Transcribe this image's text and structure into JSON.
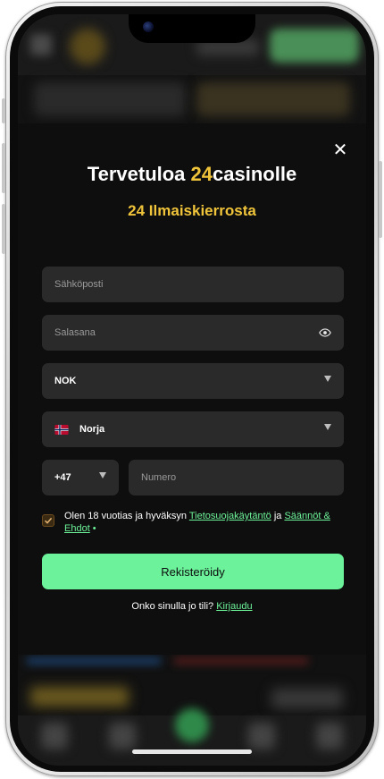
{
  "modal": {
    "close_glyph": "✕",
    "title_prefix": "Tervetuloa ",
    "title_accent": "24",
    "title_suffix": "casinolle",
    "subtitle": "24 Ilmaiskierrosta"
  },
  "form": {
    "email_placeholder": "Sähköposti",
    "password_placeholder": "Salasana",
    "currency_value": "NOK",
    "country_value": "Norja",
    "phone_code_value": "+47",
    "phone_number_placeholder": "Numero",
    "terms_prefix": "Olen 18 vuotias ja hyväksyn ",
    "privacy_link": "Tietosuojakäytäntö",
    "terms_and": " ja ",
    "rules_link": "Säännöt & Ehdot",
    "terms_dot": " •",
    "terms_checked": true,
    "register_label": "Rekisteröidy",
    "login_prompt": "Onko sinulla jo tili? ",
    "login_link": "Kirjaudu"
  },
  "colors": {
    "accent_gold": "#f0c43a",
    "accent_green": "#6bf29b",
    "field_bg": "#2a2a2a",
    "modal_bg": "#0e0e0e"
  },
  "icons": {
    "close": "close-icon",
    "password_toggle": "eye-icon",
    "dropdown": "caret-down-icon",
    "country_flag": "norway-flag-icon",
    "checkbox": "checkmark-icon"
  }
}
